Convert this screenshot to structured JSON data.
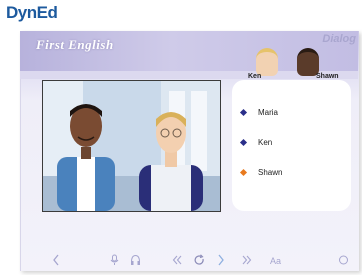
{
  "brand": "DynEd",
  "app_title": "First English",
  "section_title": "Dialog",
  "characters": [
    {
      "name": "Ken"
    },
    {
      "name": "Shawn"
    }
  ],
  "speakers": [
    {
      "label": "Maria",
      "color": "#2a2f8a"
    },
    {
      "label": "Ken",
      "color": "#2a2f8a"
    },
    {
      "label": "Shawn",
      "color": "#e87a1e"
    }
  ],
  "toolbar": {
    "back_icon": "chevron-left-icon",
    "microphone_icon": "microphone-icon",
    "headphones_icon": "headphones-icon",
    "rewind_icon": "double-chevron-left-icon",
    "repeat_icon": "repeat-icon",
    "next_icon": "chevron-right-icon",
    "fast_forward_icon": "double-chevron-right-icon",
    "text_icon": "text-icon",
    "text_label": "Aa",
    "menu_icon": "circle-icon",
    "accent": "#a6a6cf"
  }
}
